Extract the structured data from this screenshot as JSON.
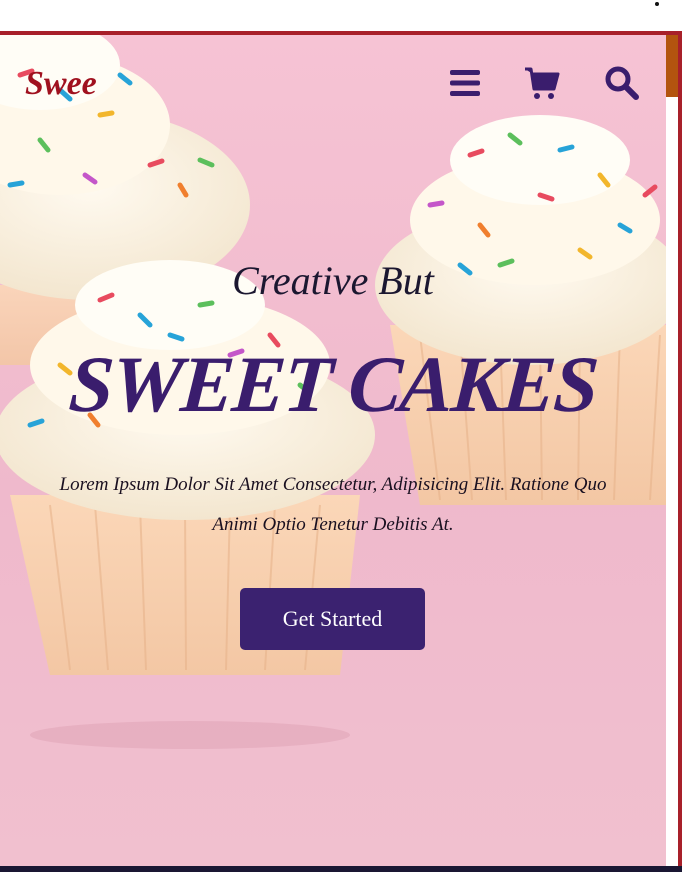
{
  "header": {
    "logo": "Swee",
    "icons": [
      "menu-icon",
      "cart-icon",
      "search-icon"
    ],
    "icon_color": "#3a1d6d",
    "logo_color": "#a0111f"
  },
  "hero": {
    "subtitle": "Creative But",
    "title": "SWEET CAKES",
    "description": "Lorem Ipsum Dolor Sit Amet Consectetur, Adipisicing Elit. Ratione Quo Animi Optio Tenetur Debitis At.",
    "button_label": "Get Started",
    "background_color": "#f6c3d4",
    "accent_color": "#3b2270"
  }
}
